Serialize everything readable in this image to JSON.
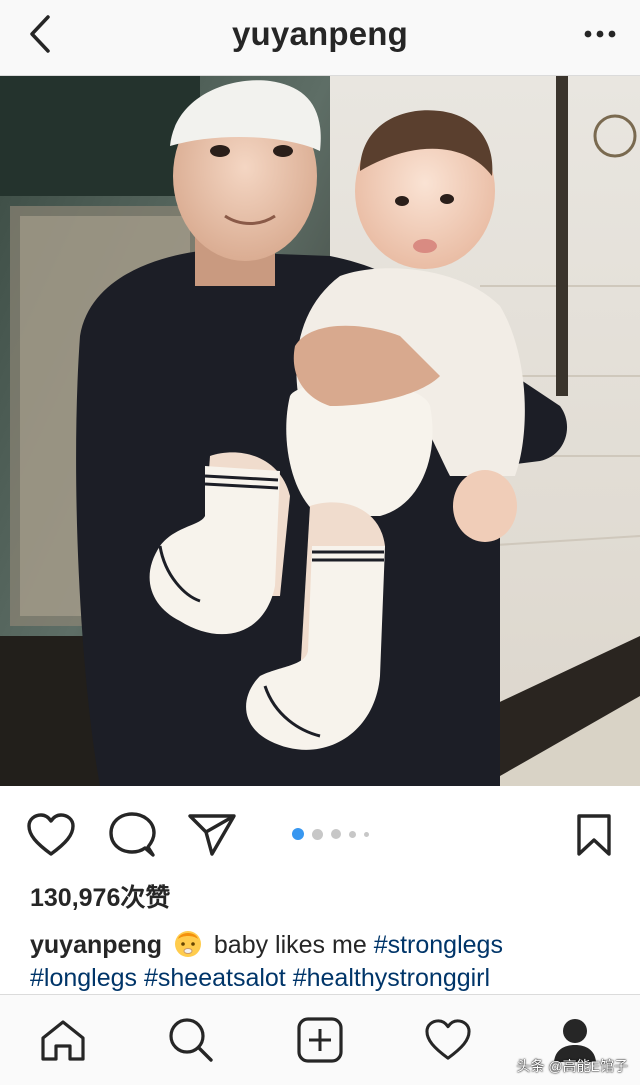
{
  "header": {
    "username": "yuyanpeng",
    "back_icon": "chevron-left-icon",
    "more_icon": "more-horizontal-icon"
  },
  "post": {
    "image_description_icon": "photo",
    "carousel": {
      "count": 5,
      "active_index": 0
    },
    "likes_text": "130,976次赞",
    "caption": {
      "username": "yuyanpeng",
      "emoji": "baby-emoji",
      "text": "baby likes me",
      "tags_line1": [
        "#stronglegs"
      ],
      "tags_line2": [
        "#longlegs",
        "#sheeatsalot",
        "#healthystronggirl"
      ]
    }
  },
  "actions": {
    "like_icon": "heart-icon",
    "comment_icon": "comment-icon",
    "share_icon": "send-icon",
    "save_icon": "bookmark-icon"
  },
  "tabbar": {
    "items": [
      "home-icon",
      "search-icon",
      "add-post-icon",
      "activity-heart-icon",
      "profile-icon"
    ]
  },
  "watermark": "头条 @高能E馆子",
  "colors": {
    "active_dot": "#3897f0",
    "hashtag": "#003569",
    "text": "#262626"
  }
}
